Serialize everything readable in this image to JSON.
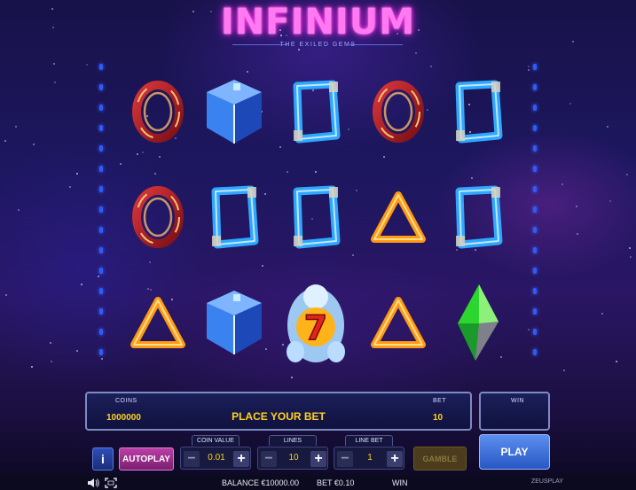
{
  "logo": {
    "title_big": "INFINIU",
    "title_end": "M",
    "subtitle": "THE EXILED GEMS"
  },
  "reels": [
    [
      "ring",
      "ring",
      "triangle"
    ],
    [
      "cube",
      "frame",
      "cube"
    ],
    [
      "frame",
      "frame",
      "seven"
    ],
    [
      "ring",
      "triangle",
      "triangle"
    ],
    [
      "frame",
      "frame",
      "green-gem"
    ]
  ],
  "panel": {
    "coins_label": "COINS",
    "coins_value": "1000000",
    "message": "PLACE YOUR BET",
    "bet_label": "BET",
    "bet_value": "10",
    "win_label": "WIN",
    "win_value": ""
  },
  "controls": {
    "info_label": "i",
    "autoplay_label": "AUTOPLAY",
    "coin_value_label": "COIN VALUE",
    "coin_value": "0.01",
    "lines_label": "LINES",
    "lines_value": "10",
    "line_bet_label": "LINE BET",
    "line_bet_value": "1",
    "gamble_label": "GAMBLE",
    "play_label": "PLAY",
    "minus": "−",
    "plus": "+"
  },
  "status": {
    "balance": "BALANCE €10000.00",
    "bet": "BET €0.10",
    "win": "WIN",
    "provider": "ZEUSPLAY"
  },
  "colors": {
    "accent_yellow": "#ffd21e",
    "play_blue": "#2857c4",
    "autoplay_pink": "#b93fa6",
    "gamble_disabled": "#4a3c1c"
  }
}
